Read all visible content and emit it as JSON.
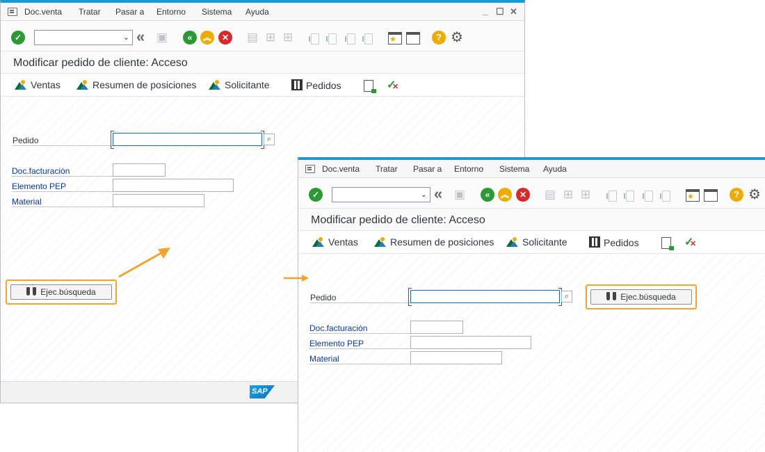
{
  "menu": [
    "Doc.venta",
    "Tratar",
    "Pasar a",
    "Entorno",
    "Sistema",
    "Ayuda"
  ],
  "window_controls": [
    "☐",
    "✕"
  ],
  "title": "Modificar pedido de cliente: Acceso",
  "app_toolbar": {
    "ventas": "Ventas",
    "resumen": "Resumen de posiciones",
    "solicitante": "Solicitante",
    "pedidos": "Pedidos"
  },
  "form": {
    "pedido_label": "Pedido",
    "pedido_value": "",
    "doc_facturacion_label": "Doc.facturación",
    "elemento_pep_label": "Elemento PEP",
    "material_label": "Material"
  },
  "exec_button": "Ejec.búsqueda",
  "sap_logo": "SAP",
  "colors": {
    "accent": "#1a9bd7",
    "highlight": "#f0a52e",
    "ok_green": "#2b9a35",
    "cancel_red": "#d9292b",
    "nav_orange": "#f0ab00"
  },
  "icons": [
    "menu-icon",
    "enter-check-icon",
    "back-icon",
    "save-icon",
    "back-green-icon",
    "exit-up-icon",
    "cancel-icon",
    "print-icon",
    "find-icon",
    "find-next-icon",
    "first-page-icon",
    "prev-page-icon",
    "next-page-icon",
    "last-page-icon",
    "new-session-icon",
    "shortcut-icon",
    "help-icon",
    "settings-gear-icon",
    "binoculars-icon",
    "search-help-icon"
  ]
}
